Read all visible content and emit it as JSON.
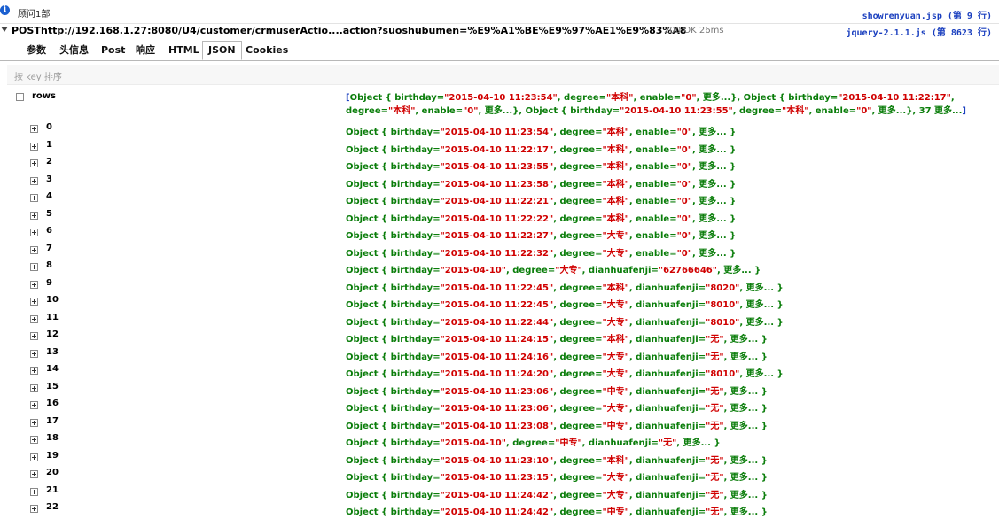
{
  "console": {
    "info_text": "顾问1部",
    "source_1": "showrenyuan.jsp (第 9 行)",
    "source_2": "jquery-2.1.1.js (第 8623 行)"
  },
  "request": {
    "method": "POST",
    "url": "http://192.168.1.27:8080/U4/customer/crmuserActio....action?suoshubumen=%E9%A1%BE%E9%97%AE1%E9%83%A8",
    "status": "200 OK 26ms"
  },
  "tabs": [
    "参数",
    "头信息",
    "Post",
    "响应",
    "HTML",
    "JSON",
    "Cookies"
  ],
  "active_tab": "JSON",
  "sort_label": "按 key 排序",
  "root": {
    "key": "rows",
    "summary": [
      {
        "t": "[",
        "c": "b"
      },
      {
        "t": "Object { birthday=",
        "c": "g"
      },
      {
        "t": "\"2015-04-10 11:23:54\"",
        "c": "r"
      },
      {
        "t": ", degree=",
        "c": "g"
      },
      {
        "t": "\"本科\"",
        "c": "r"
      },
      {
        "t": ", enable=",
        "c": "g"
      },
      {
        "t": "\"0\"",
        "c": "r"
      },
      {
        "t": ", 更多...}, ",
        "c": "g"
      },
      {
        "t": "Object { birthday=",
        "c": "g"
      },
      {
        "t": "\"2015-04-10 11:22:17\"",
        "c": "r"
      },
      {
        "t": ", degree=",
        "c": "g"
      },
      {
        "t": "\"本科\"",
        "c": "r"
      },
      {
        "t": ", enable=",
        "c": "g"
      },
      {
        "t": "\"0\"",
        "c": "r"
      },
      {
        "t": ", 更多...}, ",
        "c": "g"
      },
      {
        "t": "Object { birthday=",
        "c": "g"
      },
      {
        "t": "\"2015-04-10 11:23:55\"",
        "c": "r"
      },
      {
        "t": ", degree=",
        "c": "g"
      },
      {
        "t": "\"本科\"",
        "c": "r"
      },
      {
        "t": ", enable=",
        "c": "g"
      },
      {
        "t": "\"0\"",
        "c": "r"
      },
      {
        "t": ", 更多...}, 37 更多...",
        "c": "g"
      },
      {
        "t": "]",
        "c": "b"
      }
    ]
  },
  "rows": [
    {
      "k": "0",
      "bd": "2015-04-10 11:23:54",
      "dg": "本科",
      "f": "enable",
      "v": "0"
    },
    {
      "k": "1",
      "bd": "2015-04-10 11:22:17",
      "dg": "本科",
      "f": "enable",
      "v": "0"
    },
    {
      "k": "2",
      "bd": "2015-04-10 11:23:55",
      "dg": "本科",
      "f": "enable",
      "v": "0"
    },
    {
      "k": "3",
      "bd": "2015-04-10 11:23:58",
      "dg": "本科",
      "f": "enable",
      "v": "0"
    },
    {
      "k": "4",
      "bd": "2015-04-10 11:22:21",
      "dg": "本科",
      "f": "enable",
      "v": "0"
    },
    {
      "k": "5",
      "bd": "2015-04-10 11:22:22",
      "dg": "本科",
      "f": "enable",
      "v": "0"
    },
    {
      "k": "6",
      "bd": "2015-04-10 11:22:27",
      "dg": "大专",
      "f": "enable",
      "v": "0"
    },
    {
      "k": "7",
      "bd": "2015-04-10 11:22:32",
      "dg": "大专",
      "f": "enable",
      "v": "0"
    },
    {
      "k": "8",
      "bd": "2015-04-10",
      "dg": "大专",
      "f": "dianhuafenji",
      "v": "62766646"
    },
    {
      "k": "9",
      "bd": "2015-04-10 11:22:45",
      "dg": "本科",
      "f": "dianhuafenji",
      "v": "8020"
    },
    {
      "k": "10",
      "bd": "2015-04-10 11:22:45",
      "dg": "大专",
      "f": "dianhuafenji",
      "v": "8010"
    },
    {
      "k": "11",
      "bd": "2015-04-10 11:22:44",
      "dg": "大专",
      "f": "dianhuafenji",
      "v": "8010"
    },
    {
      "k": "12",
      "bd": "2015-04-10 11:24:15",
      "dg": "本科",
      "f": "dianhuafenji",
      "v": "无"
    },
    {
      "k": "13",
      "bd": "2015-04-10 11:24:16",
      "dg": "大专",
      "f": "dianhuafenji",
      "v": "无"
    },
    {
      "k": "14",
      "bd": "2015-04-10 11:24:20",
      "dg": "大专",
      "f": "dianhuafenji",
      "v": "8010"
    },
    {
      "k": "15",
      "bd": "2015-04-10 11:23:06",
      "dg": "中专",
      "f": "dianhuafenji",
      "v": "无"
    },
    {
      "k": "16",
      "bd": "2015-04-10 11:23:06",
      "dg": "大专",
      "f": "dianhuafenji",
      "v": "无"
    },
    {
      "k": "17",
      "bd": "2015-04-10 11:23:08",
      "dg": "中专",
      "f": "dianhuafenji",
      "v": "无"
    },
    {
      "k": "18",
      "bd": "2015-04-10",
      "dg": "中专",
      "f": "dianhuafenji",
      "v": "无"
    },
    {
      "k": "19",
      "bd": "2015-04-10 11:23:10",
      "dg": "本科",
      "f": "dianhuafenji",
      "v": "无"
    },
    {
      "k": "20",
      "bd": "2015-04-10 11:23:15",
      "dg": "大专",
      "f": "dianhuafenji",
      "v": "无"
    },
    {
      "k": "21",
      "bd": "2015-04-10 11:24:42",
      "dg": "大专",
      "f": "dianhuafenji",
      "v": "无"
    },
    {
      "k": "22",
      "bd": "2015-04-10 11:24:42",
      "dg": "中专",
      "f": "dianhuafenji",
      "v": "无"
    }
  ],
  "object_prefix": "Object { birthday=",
  "degree_label": ", degree=",
  "more_label": ", 更多... }",
  "colors": {
    "key_green": "#0a7d0a",
    "value_red": "#d00000",
    "bracket_blue": "#1a3fbf",
    "link_blue": "#1a3fbf"
  }
}
